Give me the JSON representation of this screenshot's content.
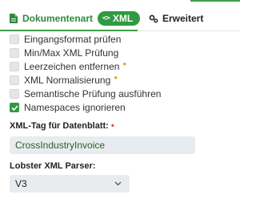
{
  "tabs": {
    "document_type": {
      "label": "Dokumentenart",
      "icon": "document-icon"
    },
    "xml": {
      "label": "XML",
      "icon": "code-icon",
      "glyph": "<>"
    },
    "advanced": {
      "label": "Erweitert",
      "icon": "gear-icon"
    }
  },
  "options": [
    {
      "label": "Eingangsformat prüfen",
      "checked": false,
      "info": false
    },
    {
      "label": "Min/Max XML Prüfung",
      "checked": false,
      "info": false
    },
    {
      "label": "Leerzeichen entfernen",
      "checked": false,
      "info": true
    },
    {
      "label": "XML Normalisierung",
      "checked": false,
      "info": true
    },
    {
      "label": "Semantische Prüfung ausführen",
      "checked": false,
      "info": false
    },
    {
      "label": "Namespaces ignorieren",
      "checked": true,
      "info": false
    }
  ],
  "xml_tag": {
    "label": "XML-Tag für Datenblatt:",
    "required_marker": "•",
    "value": "CrossIndustryInvoice"
  },
  "parser": {
    "label": "Lobster XML Parser:",
    "value": "V3"
  },
  "colors": {
    "accent": "#2f9a41",
    "info": "#e0a21a",
    "required": "#d9473c",
    "field_bg": "#e9ecef"
  }
}
